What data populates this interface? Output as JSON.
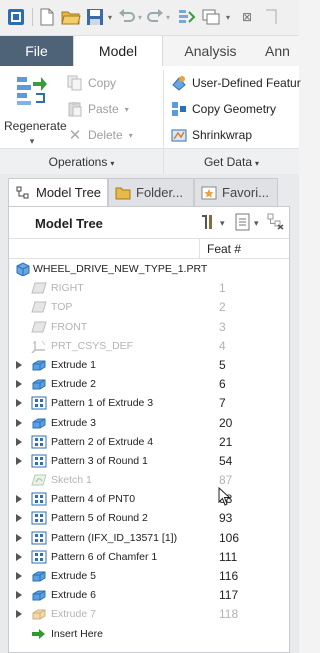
{
  "quick_access": {
    "icons": [
      "app-menu-icon",
      "new-icon",
      "open-icon",
      "save-icon",
      "undo-icon",
      "redo-icon",
      "regenerate-icon",
      "windows-icon",
      "close-window-icon"
    ]
  },
  "tabs": [
    {
      "label": "File"
    },
    {
      "label": "Model"
    },
    {
      "label": "Analysis"
    },
    {
      "label": "Ann"
    }
  ],
  "ribbon": {
    "regenerate_label": "Regenerate",
    "copy_label": "Copy",
    "paste_label": "Paste",
    "delete_label": "Delete",
    "user_defined_label": "User-Defined Featur",
    "copy_geometry_label": "Copy Geometry",
    "shrinkwrap_label": "Shrinkwrap",
    "operations_label": "Operations",
    "get_data_label": "Get Data"
  },
  "navigator": {
    "tabs": [
      {
        "label": "Model Tree"
      },
      {
        "label": "Folder..."
      },
      {
        "label": "Favori..."
      }
    ],
    "tree_title": "Model Tree",
    "column_header": "Feat #",
    "root": "WHEEL_DRIVE_NEW_TYPE_1.PRT",
    "rows": [
      {
        "name": "RIGHT",
        "feat": "1",
        "dim": true,
        "icon": "datum-plane-icon",
        "expand": false
      },
      {
        "name": "TOP",
        "feat": "2",
        "dim": true,
        "icon": "datum-plane-icon",
        "expand": false
      },
      {
        "name": "FRONT",
        "feat": "3",
        "dim": true,
        "icon": "datum-plane-icon",
        "expand": false
      },
      {
        "name": "PRT_CSYS_DEF",
        "feat": "4",
        "dim": true,
        "icon": "csys-icon",
        "expand": false
      },
      {
        "name": "Extrude 1",
        "feat": "5",
        "dim": false,
        "icon": "extrude-icon",
        "expand": true
      },
      {
        "name": "Extrude 2",
        "feat": "6",
        "dim": false,
        "icon": "extrude-icon",
        "expand": true
      },
      {
        "name": "Pattern 1 of Extrude 3",
        "feat": "7",
        "dim": false,
        "icon": "pattern-icon",
        "expand": true
      },
      {
        "name": "Extrude 3",
        "feat": "20",
        "dim": false,
        "icon": "extrude-icon",
        "expand": true
      },
      {
        "name": "Pattern 2 of Extrude 4",
        "feat": "21",
        "dim": false,
        "icon": "pattern-icon",
        "expand": true
      },
      {
        "name": "Pattern 3 of Round 1",
        "feat": "54",
        "dim": false,
        "icon": "pattern-icon",
        "expand": true
      },
      {
        "name": "Sketch 1",
        "feat": "87",
        "dim": true,
        "icon": "sketch-icon",
        "expand": false
      },
      {
        "name": "Pattern 4 of PNT0",
        "feat": "88",
        "dim": false,
        "icon": "pattern-icon",
        "expand": true
      },
      {
        "name": "Pattern 5 of Round 2",
        "feat": "93",
        "dim": false,
        "icon": "pattern-icon",
        "expand": true
      },
      {
        "name": "Pattern (IFX_ID_13571 [1])",
        "feat": "106",
        "dim": false,
        "icon": "pattern-icon",
        "expand": true
      },
      {
        "name": "Pattern 6 of Chamfer 1",
        "feat": "111",
        "dim": false,
        "icon": "pattern-icon",
        "expand": true
      },
      {
        "name": "Extrude 5",
        "feat": "116",
        "dim": false,
        "icon": "extrude-icon",
        "expand": true
      },
      {
        "name": "Extrude 6",
        "feat": "117",
        "dim": false,
        "icon": "extrude-icon",
        "expand": true
      },
      {
        "name": "Extrude 7",
        "feat": "118",
        "dim": true,
        "icon": "extrude-icon",
        "expand": true
      },
      {
        "name": "Insert Here",
        "feat": "",
        "dim": false,
        "icon": "insert-arrow-icon",
        "expand": false
      }
    ]
  },
  "colors": {
    "file_tab": "#4f6378",
    "accent_blue": "#2a7fd4",
    "dim_text": "#b3b3b3"
  }
}
